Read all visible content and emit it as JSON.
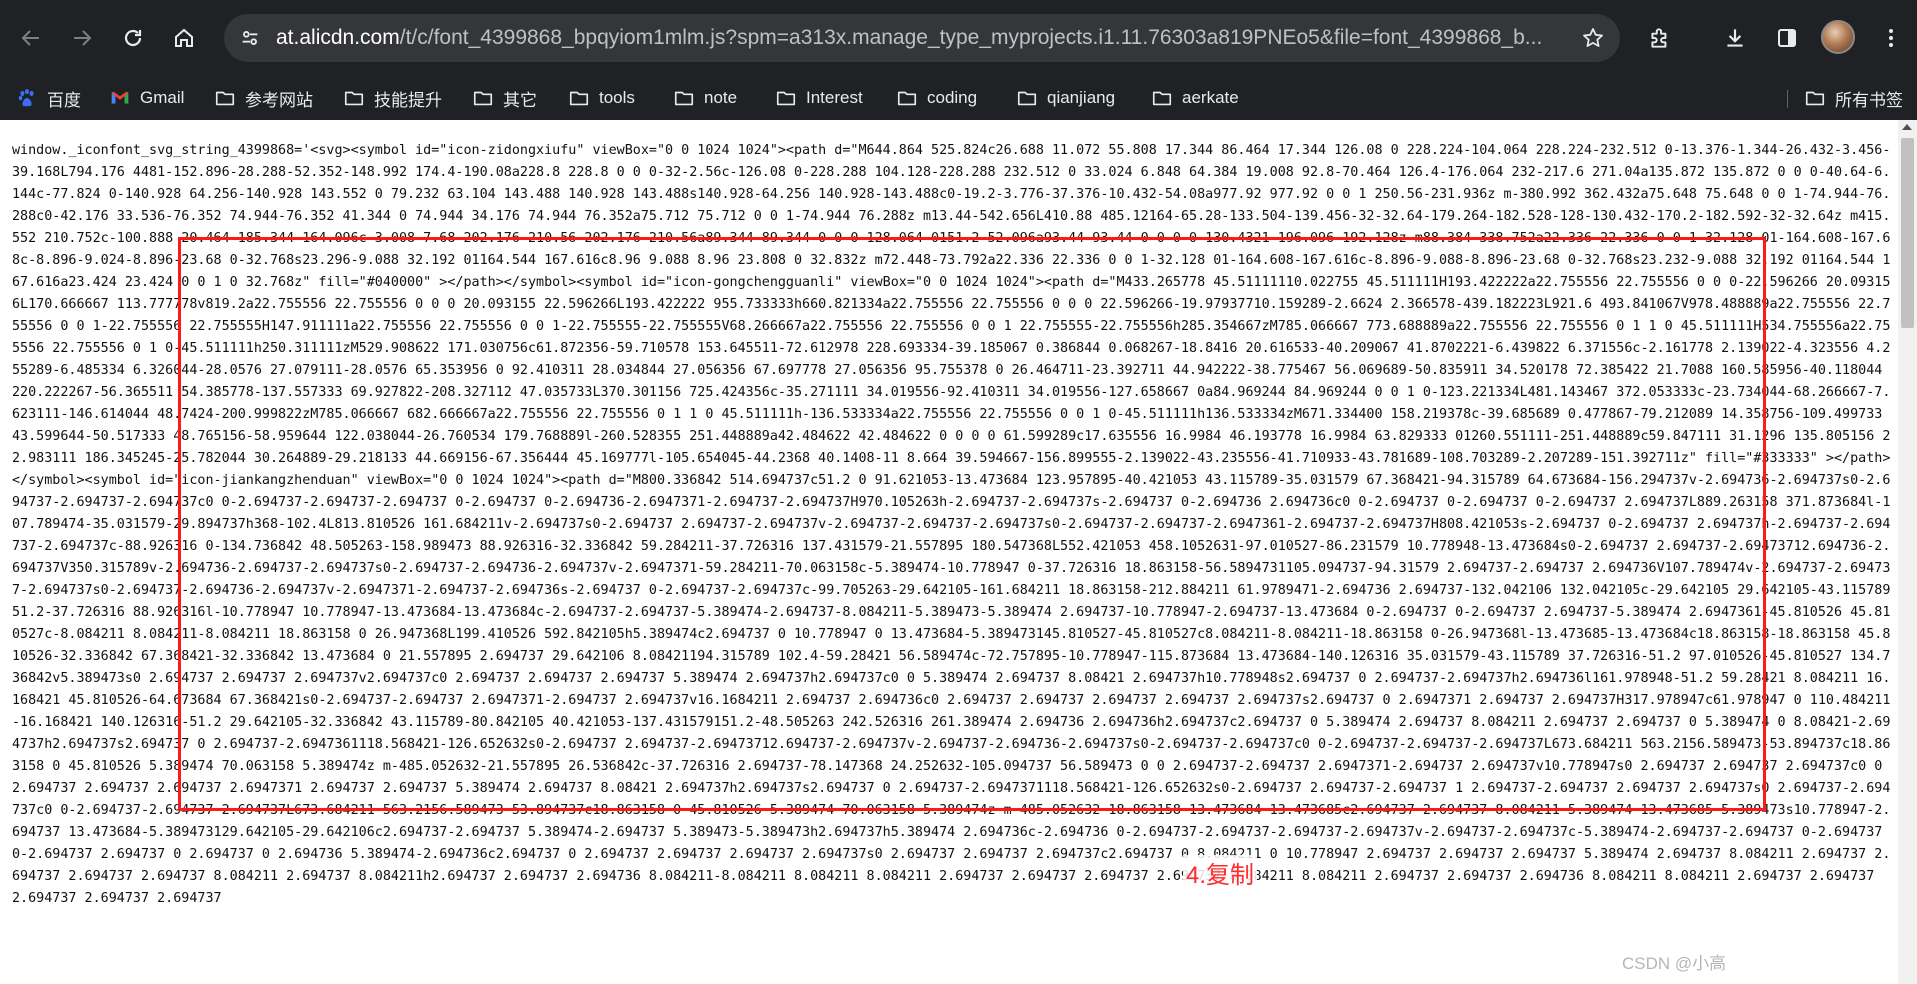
{
  "browser": {
    "url_host": "at.alicdn.com",
    "url_path": "/t/c/font_4399868_bpqyiom1mlm.js?spm=a313x.manage_type_myprojects.i1.11.76303a819PNEo5&file=font_4399868_b...",
    "icons": {
      "back": "arrow-left-icon",
      "forward": "arrow-right-icon",
      "reload": "reload-icon",
      "home": "home-icon",
      "site_info": "tune-icon",
      "bookmark": "star-icon",
      "extensions": "puzzle-icon",
      "download": "download-icon",
      "side_panel": "side-panel-icon",
      "menu": "kebab-menu-icon"
    }
  },
  "bookmarks": [
    {
      "label": "百度",
      "icon": "baidu-paw-icon"
    },
    {
      "label": "Gmail",
      "icon": "gmail-icon"
    },
    {
      "label": "参考网站",
      "icon": "folder-icon"
    },
    {
      "label": "技能提升",
      "icon": "folder-icon"
    },
    {
      "label": "其它",
      "icon": "folder-icon"
    },
    {
      "label": "tools",
      "icon": "folder-icon"
    },
    {
      "label": "note",
      "icon": "folder-icon"
    },
    {
      "label": "Interest",
      "icon": "folder-icon"
    },
    {
      "label": "coding",
      "icon": "folder-icon"
    },
    {
      "label": "qianjiang",
      "icon": "folder-icon"
    },
    {
      "label": "aerkate",
      "icon": "folder-icon"
    }
  ],
  "all_bookmarks": "所有书签",
  "code_text": "window._iconfont_svg_string_4399868='<svg><symbol id=\"icon-zidongxiufu\" viewBox=\"0 0 1024 1024\"><path d=\"M644.864 525.824c26.688 11.072 55.808 17.344 86.464 17.344 126.08 0 228.224-104.064 228.224-232.512 0-13.376-1.344-26.432-3.456-39.168L794.176 4481-152.896-28.288-52.352-148.992 174.4-190.08a228.8 228.8 0 0 0-32-2.56c-126.08 0-228.288 104.128-228.288 232.512 0 33.024 6.848 64.384 19.008 92.8-70.464 126.4-176.064 232-217.6 271.04a135.872 135.872 0 0 0-40.64-6.144c-77.824 0-140.928 64.256-140.928 143.552 0 79.232 63.104 143.488 140.928 143.488s140.928-64.256 140.928-143.488c0-19.2-3.776-37.376-10.432-54.08a977.92 977.92 0 0 1 250.56-231.936z m-380.992 362.432a75.648 75.648 0 0 1-74.944-76.288c0-42.176 33.536-76.352 74.944-76.352 41.344 0 74.944 34.176 74.944 76.352a75.712 75.712 0 0 1-74.944 76.288z m13.44-542.656L410.88 485.12164-65.28-133.504-139.456-32-32.64-179.264-182.528-128-130.432-170.2-182.592-32-32.64z m415.552 210.752c-100.888 20.464-185.344 164.096c-3.008-7.68 202.176 210.56 202.176 210.56a89.344 89.344 0 0 0 128.064 0151.2-52.096a93.44 93.44 0 0 0 0-130.4321-196.096-192.128z m88.384 338.752a22.336 22.336 0 0 1-32.128 01-164.608-167.68c-8.896-9.024-8.896-23.68 0-32.768s23.296-9.088 32.192 01164.544 167.616c8.96 9.088 8.96 23.808 0 32.832z m72.448-73.792a22.336 22.336 0 0 1-32.128 01-164.608-167.616c-8.896-9.088-8.896-23.68 0-32.768s23.232-9.088 32.192 01164.544 167.616a23.424 23.424 0 0 1 0 32.768z\" fill=\"#040000\" ></path></symbol><symbol id=\"icon-gongchengguanli\" viewBox=\"0 0 1024 1024\"><path d=\"M433.265778 45.51111110.022755 45.511111H193.422222a22.755556 22.755556 0 0 0-22.596266 20.093156L170.666667 113.777778v819.2a22.755556 22.755556 0 0 0 20.093155 22.596266L193.422222 955.733333h660.821334a22.755556 22.755556 0 0 0 22.596266-19.97937710.159289-2.6624 2.366578-439.182223L921.6 493.841067V978.488889a22.755556 22.755556 0 0 1-22.755556 22.755555H147.911111a22.755556 22.755556 0 0 1-22.755555-22.755555V68.266667a22.755556 22.755556 0 0 1 22.755555-22.755556h285.354667zM785.066667 773.688889a22.755556 22.755556 0 1 1 0 45.511111H534.755556a22.755556 22.755556 0 1 0-45.511111h250.311111zM529.908622 171.030756c61.872356-59.710578 153.645511-72.612978 228.693334-39.185067 0.386844 0.068267-18.8416 20.616533-40.209067 41.8702221-6.439822 6.371556c-2.161778 2.139022-4.323556 4.255289-6.485334 6.326044-28.0576 27.079111-28.0576 65.353956 0 92.410311 28.034844 27.056356 67.697778 27.056356 95.755378 0 26.464711-23.392711 44.942222-38.775467 56.069689-50.835911 34.520178 72.385422 21.7088 160.585956-40.118044 220.222267-56.365511 54.385778-137.557333 69.927822-208.327112 47.035733L370.301156 725.424356c-35.271111 34.019556-92.410311 34.019556-127.658667 0a84.969244 84.969244 0 0 1 0-123.221334L481.143467 372.053333c-23.734044-68.266667-7.623111-146.614044 48.7424-200.999822zM785.066667 682.666667a22.755556 22.755556 0 1 1 0 45.511111h-136.533334a22.755556 22.755556 0 0 1 0-45.511111h136.533334zM671.334400 158.219378c-39.685689 0.477867-79.212089 14.358756-109.499733 43.599644-50.517333 48.765156-58.959644 122.038044-26.760534 179.768889l-260.528355 251.448889a42.484622 42.484622 0 0 0 0 61.599289c17.635556 16.9984 46.193778 16.9984 63.829333 01260.551111-251.448889c59.847111 31.1296 135.805156 22.983111 186.345245-25.782044 30.264889-29.218133 44.669156-67.356444 45.169777l-105.654045-44.2368 40.1408-11 8.664 39.594667-156.899555-2.139022-43.235556-41.710933-43.781689-108.703289-2.207289-151.392711z\" fill=\"#333333\" ></path></symbol><symbol id=\"icon-jiankangzhenduan\" viewBox=\"0 0 1024 1024\"><path d=\"M800.336842 514.694737c51.2 0 91.621053-13.473684 123.957895-40.421053 43.115789-35.031579 67.368421-94.315789 64.673684-156.294737v-2.694736-2.694737s0-2.694737-2.694737-2.694737c0 0-2.694737-2.694737-2.694737 0-2.694737 0-2.694736-2.6947371-2.694737-2.694737H970.105263h-2.694737-2.694737s-2.694737 0-2.694736 2.694736c0 0-2.694737 0-2.694737 0-2.694737 2.694737L889.263158 371.873684l-107.789474-35.031579-29.894737h368-102.4L813.810526 161.684211v-2.694737s0-2.694737 2.694737-2.694737v-2.694737-2.694737-2.694737s0-2.694737-2.694737-2.6947361-2.694737-2.694737H808.421053s-2.694737 0-2.694737 2.694737h-2.694737-2.694737-2.694737c-88.926316 0-134.736842 48.505263-158.989473 88.926316-32.336842 59.284211-37.726316 137.431579-21.557895 180.547368L552.421053 458.1052631-97.010527-86.231579 10.778948-13.473684s0-2.694737 2.694737-2.69473712.694736-2.694737V350.315789v-2.694736-2.694737-2.694737s0-2.694737-2.694736-2.694737v-2.6947371-59.284211-70.063158c-5.389474-10.778947 0-37.726316 18.863158-56.5894731105.094737-94.31579 2.694737-2.694737 2.694736V107.789474v-2.694737-2.694737-2.694737s0-2.694737-2.694736-2.694737v-2.6947371-2.694737-2.694736s-2.694737 0-2.694737-2.694737c-99.705263-29.642105-161.684211 18.863158-212.884211 61.9789471-2.694736 2.694737-132.042106 132.042105c-29.642105 29.642105-43.115789 51.2-37.726316 88.926316l-10.778947 10.778947-13.473684-13.473684c-2.694737-2.694737-5.389474-2.694737-8.084211-5.389473-5.389474 2.694737-10.778947-2.694737-13.473684 0-2.694737 0-2.694737 2.694737-5.389474 2.6947361-45.810526 45.810527c-8.084211 8.084211-8.084211 18.863158 0 26.947368L199.410526 592.842105h5.389474c2.694737 0 10.778947 0 13.473684-5.389473145.810527-45.810527c8.084211-8.084211-18.863158 0-26.947368l-13.473685-13.473684c18.863158-18.863158 45.810526-32.336842 67.368421-32.336842 13.473684 0 21.557895 2.694737 29.642106 8.08421194.315789 102.4-59.28421 56.589474c-72.757895-10.778947-115.873684 13.473684-140.126316 35.031579-43.115789 37.726316-51.2 97.010526-45.810527 134.736842v5.389473s0 2.694737 2.694737 2.694737v2.694737c0 2.694737 2.694737 2.694737 5.389474 2.694737h2.694737c0 0 5.389474 2.694737 8.08421 2.694737h10.778948s2.694737 0 2.694737-2.694737h2.694736l161.978948-51.2 59.28421 8.084211 16.168421 45.810526-64.673684 67.368421s0-2.694737-2.694737 2.6947371-2.694737 2.694737v16.1684211 2.694737 2.694736c0 2.694737 2.694737 2.694737 2.694737 2.694737s2.694737 0 2.6947371 2.694737 2.694737H317.978947c61.978947 0 110.484211-16.168421 140.126316-51.2 29.642105-32.336842 43.115789-80.842105 40.421053-137.431579151.2-48.505263 242.526316 261.389474 2.694736 2.694736h2.694737c2.694737 0 5.389474 2.694737 8.084211 2.694737 2.694737 0 5.389474 0 8.08421-2.694737h2.694737s2.694737 0 2.694737-2.6947361118.568421-126.652632s0-2.694737 2.694737-2.69473712.694737-2.694737v-2.694737-2.694736-2.694737s0-2.694737-2.694737c0 0-2.694737-2.694737-2.694737L673.684211 563.2156.589473-53.894737c18.863158 0 45.810526 5.389474 70.063158 5.389474z m-485.052632-21.557895 26.536842c-37.726316 2.694737-78.147368 24.252632-105.094737 56.589473 0 0 2.694737-2.694737 2.6947371-2.694737 2.694737v10.778947s0 2.694737 2.694737 2.694737c0 0 2.694737 2.694737 2.694737 2.6947371 2.694737 2.694737 5.389474 2.694737 8.08421 2.694737h2.694737s2.694737 0 2.694737-2.6947371118.568421-126.652632s0-2.694737 2.694737-2.694737 1 2.694737-2.694737 2.694737 2.694737s0 2.694737-2.694737c0 0-2.694737-2.694737-2.694737L673.684211 563.2156.589473-53.894737c18.863158 0 45.810526 5.389474 70.063158 5.389474z m-485.052632 18.863158 13.473684 13.473685c2.694737 2.694737 8.084211 5.389474 13.473685 5.389473s10.778947-2.694737 13.473684-5.389473129.642105-29.642106c2.694737-2.694737 5.389474-2.694737 5.389473-5.389473h2.694737h5.389474 2.694736c-2.694736 0-2.694737-2.694737-2.694737-2.694737v-2.694737-2.694737c-5.389474-2.694737-2.694737 0-2.694737 0-2.694737 2.694737 0 2.694737 0 2.694736 5.389474-2.694736c2.694737 0 2.694737 2.694737 2.694737 2.694737s0 2.694737 2.694737 2.694737c2.694737 0 8.084211 0 10.778947 2.694737 2.694737 2.694737 5.389474 2.694737 8.084211 2.694737 2.694737 2.694737 2.694737 8.084211 2.694737 8.084211h2.694737 2.694737 2.694736 8.084211-8.084211 8.084211 8.084211 2.694737 2.694737 2.694737 2.694737 8.084211 8.084211 2.694737 2.694737 2.694736 8.084211 8.084211 2.694737 2.694737 2.694737 2.694737 2.694737"
}
